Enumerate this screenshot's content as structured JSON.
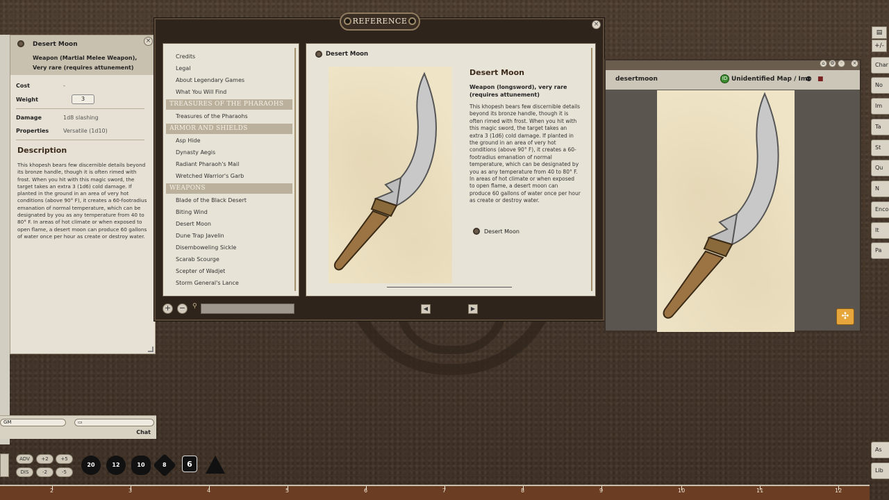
{
  "sheet": {
    "title": "Desert Moon",
    "subtitle": "Weapon (Martial Melee Weapon), Very rare (requires attunement)",
    "cost_label": "Cost",
    "cost_value": "-",
    "weight_label": "Weight",
    "weight_value": "3",
    "damage_label": "Damage",
    "damage_value": "1d8 slashing",
    "properties_label": "Properties",
    "properties_value": "Versatile (1d10)",
    "description_heading": "Description",
    "description": "This khopesh bears few discernible details beyond its bronze handle, though it is often rimed with frost. When you hit with this magic sword, the target takes an extra 3 (1d6) cold damage. If planted in the ground in an area of very hot conditions (above 90° F), it creates a 60-footradius emanation of normal temperature, which can be designated by you as any temperature from 40 to 80° F. In areas of hot climate or when exposed to open flame, a desert moon can produce 60 gallons of water once per hour as create or destroy water."
  },
  "chat": {
    "mode": "GM",
    "label": "Chat"
  },
  "reference": {
    "window_title": "REFERENCE",
    "toc_items_top": [
      "Credits",
      "Legal",
      "About Legendary Games",
      "What You Will Find"
    ],
    "section1": "TREASURES OF THE PHARAOHS",
    "section1_items": [
      "Treasures of the Pharaohs"
    ],
    "section2": "ARMOR AND SHIELDS",
    "section2_items": [
      "Asp Hide",
      "Dynasty Aegis",
      "Radiant Pharaoh's Mail",
      "Wretched Warrior's Garb"
    ],
    "section3": "WEAPONS",
    "section3_items": [
      "Blade of the Black Desert",
      "Biting Wind",
      "Desert Moon",
      "Dune Trap Javelin",
      "Disemboweling Sickle",
      "Scarab Scourge",
      "Scepter of Wadjet",
      "Storm General's Lance"
    ],
    "page_header": "Desert Moon",
    "page_title": "Desert Moon",
    "page_subtitle": "Weapon (longsword), very rare (requires attunement)",
    "page_body": "This khopesh bears few discernible details beyond its bronze handle, though it is often rimed with frost. When you hit with this magic sword, the target takes an extra 3 (1d6) cold damage. If planted in the ground in an area of very hot conditions (above 90° F), it creates a 60-footradius emanation of normal temperature, which can be designated by you as any temperature from 40 to 80° F. In areas of hot climate or when exposed to open flame, a desert moon can produce 60 gallons of water once per hour as create or destroy water.",
    "page_link": "Desert Moon",
    "search_value": ""
  },
  "image_window": {
    "name": "desertmoon",
    "type": "Unidentified Map / Im"
  },
  "sidebar": {
    "buttons": [
      "Char",
      "No",
      "Im",
      "Ta",
      "St",
      "Qu",
      "N",
      "Enco",
      "It",
      "Pa",
      "As",
      "Lib"
    ],
    "small": [
      "+/-"
    ]
  },
  "hotbar": {
    "mods": [
      "ADV",
      "+2",
      "+5",
      "DIS",
      "-2",
      "-5"
    ],
    "dice": [
      "20",
      "12",
      "10",
      "8",
      "6"
    ]
  },
  "ruler": {
    "ticks": [
      "2",
      "3",
      "4",
      "5",
      "6",
      "7",
      "8",
      "9",
      "10",
      "11",
      "12"
    ]
  },
  "colors": {
    "leather": "#4a3a2e",
    "parchment": "#e8e3d7",
    "accent_orange": "#e6a63b",
    "id_green": "#3c8a2e"
  }
}
